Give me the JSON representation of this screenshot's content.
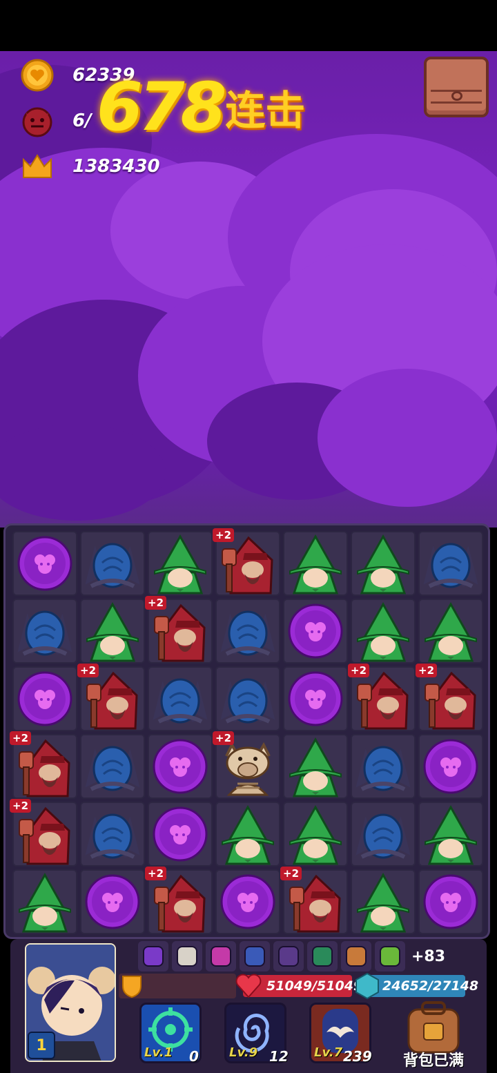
{
  "hud": {
    "coins": "62339",
    "enemies": "6/",
    "score": "1383430"
  },
  "combo": {
    "count": "678",
    "label": "连击"
  },
  "board": {
    "rows": [
      [
        "orb",
        "egg",
        "witch",
        "mage+2",
        "witch",
        "witch",
        "egg"
      ],
      [
        "egg",
        "witch",
        "mage+2",
        "egg",
        "orb",
        "witch",
        "witch"
      ],
      [
        "orb",
        "mage+2",
        "egg",
        "egg",
        "orb",
        "mage+2",
        "mage+2"
      ],
      [
        "mage+2",
        "egg",
        "orb",
        "boar+2",
        "witch",
        "egg",
        "orb"
      ],
      [
        "mage+2",
        "egg",
        "orb",
        "witch",
        "witch",
        "egg",
        "witch"
      ],
      [
        "witch",
        "orb",
        "mage+2",
        "orb",
        "mage+2",
        "witch",
        "orb"
      ]
    ],
    "bonus_label": "+2"
  },
  "player": {
    "level": "1",
    "hp": "51049/51049",
    "mp": "24652/27148",
    "buff_icons": [
      "spellbook-icon",
      "holy-cross-icon",
      "demon-scroll-icon",
      "hammer-icon",
      "potion-icon",
      "running-man-icon",
      "arrow-icon",
      "horn-icon"
    ],
    "more_buffs": "+83"
  },
  "skills": [
    {
      "level": "Lv.1",
      "count": "0",
      "icon": "target-icon"
    },
    {
      "level": "Lv.9",
      "count": "12",
      "icon": "vortex-icon"
    },
    {
      "level": "Lv.7",
      "count": "239",
      "icon": "bat-icon"
    }
  ],
  "bag": {
    "label": "背包已满"
  }
}
